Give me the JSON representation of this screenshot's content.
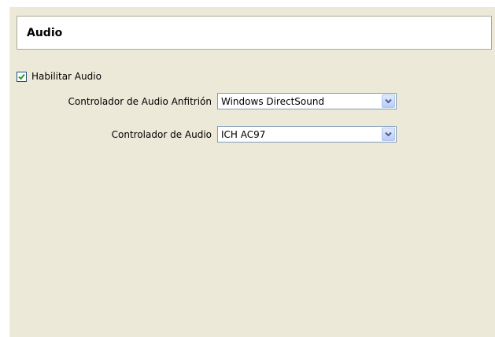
{
  "section": {
    "title": "Audio"
  },
  "enable_audio": {
    "label": "Habilitar Audio",
    "checked": true
  },
  "host_driver": {
    "label": "Controlador de Audio Anfitrión",
    "value": "Windows DirectSound"
  },
  "audio_controller": {
    "label": "Controlador de Audio",
    "value": "ICH AC97"
  },
  "icons": {
    "checkbox": "checkmark-icon",
    "dropdown": "chevron-down-icon"
  },
  "colors": {
    "panel_background": "#ece9d8",
    "input_border": "#7f9db9",
    "checkmark": "#21a121"
  }
}
